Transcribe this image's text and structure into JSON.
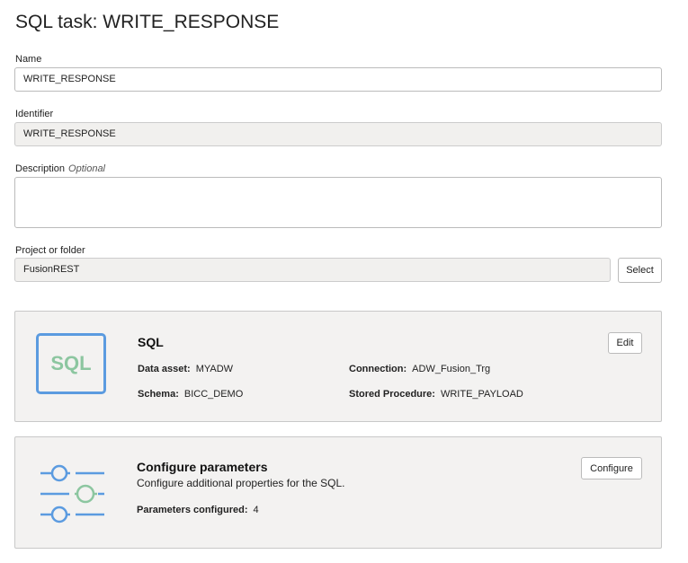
{
  "page": {
    "title": "SQL task: WRITE_RESPONSE"
  },
  "form": {
    "name_label": "Name",
    "name_value": "WRITE_RESPONSE",
    "identifier_label": "Identifier",
    "identifier_value": "WRITE_RESPONSE",
    "description_label": "Description",
    "description_optional": "Optional",
    "description_value": "",
    "project_label": "Project or folder",
    "project_value": "FusionREST",
    "select_label": "Select"
  },
  "sql_card": {
    "icon_text": "SQL",
    "title": "SQL",
    "edit_label": "Edit",
    "data_asset_label": "Data asset:",
    "data_asset": "MYADW",
    "connection_label": "Connection:",
    "connection": "ADW_Fusion_Trg",
    "schema_label": "Schema:",
    "schema": "BICC_DEMO",
    "procedure_label": "Stored Procedure:",
    "procedure": "WRITE_PAYLOAD"
  },
  "params_card": {
    "title": "Configure parameters",
    "description": "Configure additional properties for the SQL.",
    "configured_label": "Parameters configured:",
    "configured": "4",
    "configure_label": "Configure"
  },
  "colors": {
    "blue": "#5b9be0",
    "green": "#8cc6a0"
  }
}
